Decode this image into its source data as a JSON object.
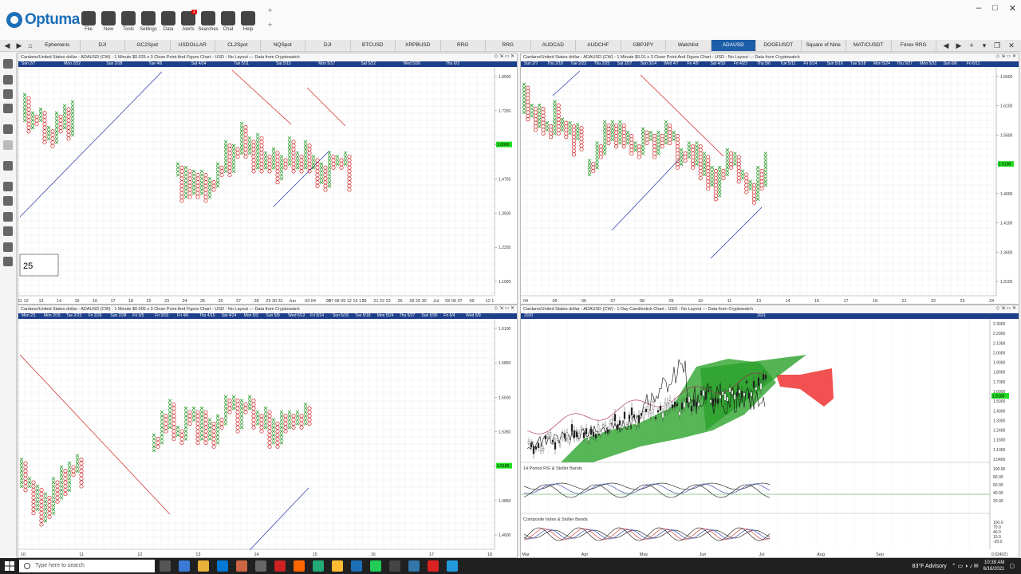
{
  "app": {
    "logo_text": "Optuma",
    "accent": "#1d5ea8",
    "toolbar": [
      {
        "label": "File",
        "icon": "folder-icon"
      },
      {
        "label": "New",
        "icon": "grid-icon"
      },
      {
        "label": "Tools",
        "icon": "tools-icon"
      },
      {
        "label": "Settings",
        "icon": "gear-icon"
      },
      {
        "label": "Data",
        "icon": "binary-icon"
      },
      {
        "label": "Alerts",
        "icon": "clock-alert-icon",
        "badge": "1"
      },
      {
        "label": "Searches",
        "icon": "search-icon"
      },
      {
        "label": "Chat",
        "icon": "chat-icon"
      },
      {
        "label": "Help",
        "icon": "help-icon"
      }
    ]
  },
  "tabs": [
    "Ephemeris",
    "DJI",
    "GC2Spot",
    "USDOLLAR",
    "CL2Spot",
    "NQSpot",
    "DJI",
    "BTCUSD",
    "XRPBUSD",
    "RRG",
    "RRG",
    "AUDCAD",
    "AUDCHF",
    "GBPJPY",
    "Watchlist",
    "ADAUSD",
    "DOGEUSDT",
    "Square of Nine",
    "MATICUSDT",
    "Forex RRG"
  ],
  "active_tab": "ADAUSD",
  "panels": {
    "tl": {
      "title": "Cardano/United States dollar - ADAUSD (CW) - 1 Minute $0.025 x 3 Close Point And Figure Chart - USD - No Layout --- Data from Cryptowatch",
      "dates": [
        "Sun 2/7",
        "Mon 2/22",
        "Sun 2/28",
        "Tue 4/6",
        "Sat 4/24",
        "Tue 5/11",
        "Sat 5/15",
        "Mon 5/17",
        "Sat 5/22",
        "Wed 5/26",
        "Thu 6/3"
      ],
      "yticks": [
        "1.8500",
        "1.7250",
        "1.6000",
        "1.4750",
        "1.3500",
        "1.2250",
        "1.1000"
      ],
      "price_tag": "1.6000",
      "xticks": [
        "11 12",
        "13",
        "14",
        "15",
        "16",
        "17",
        "18",
        "22",
        "23",
        "24",
        "25",
        "26",
        "27",
        "28",
        "29 30 31",
        "Jun",
        "03 04",
        "05",
        "07 08 09 12 16 17",
        "18",
        "21 22 23",
        "26",
        "28 29 30",
        "Jul",
        "05 06 07",
        "09",
        "12 1"
      ],
      "box_label": "25"
    },
    "tr": {
      "title": "Cardano/United States dollar - ADAUSD (CW) - 1 Minute $0.01 x 3 Close Point And Figure Chart - USD - No Layout --- Data from Cryptowatch",
      "dates": [
        "Sun 2/7",
        "Thu 2/18",
        "Tue 2/23",
        "Thu 2/25",
        "Sat 2/27",
        "Sun 3/14",
        "Wed 4/7",
        "Fri 4/9",
        "Sat 4/10",
        "Fri 4/23",
        "Thu 5/6",
        "Tue 5/11",
        "Fri 5/14",
        "Sun 5/16",
        "Tue 5/18",
        "Mon 5/24",
        "Thu 5/27",
        "Mon 5/31",
        "Sun 6/6",
        "Fri 6/11"
      ],
      "yticks": [
        "1.6600",
        "1.6100",
        "1.5600",
        "1.5100",
        "1.4600",
        "1.4100",
        "1.3600",
        "1.3100"
      ],
      "price_tag": "1.5100",
      "xticks": [
        "04",
        "05",
        "06",
        "07",
        "08",
        "09",
        "10",
        "11",
        "13",
        "14",
        "16",
        "17",
        "18",
        "21",
        "22",
        "23",
        "24"
      ]
    },
    "bl": {
      "title": "Cardano/United States dollar - ADAUSD (CW) - 1 Minute $0.005 x 3 Close Point And Figure Chart - USD - No Layout --- Data from Cryptowatch",
      "dates": [
        "Mon 2/1",
        "Mon 2/15",
        "Tue 2/23",
        "Fri 2/26",
        "Sun 2/28",
        "Fri 3/5",
        "Fri 3/19",
        "Fri 4/6",
        "Thu 4/15",
        "Sat 4/24",
        "Mon 5/3",
        "Sun 5/9",
        "Wed 5/12",
        "Fri 5/14",
        "Sun 5/16",
        "Tue 5/18",
        "Mon 5/24",
        "Thu 5/27",
        "Sun 5/30",
        "Fri 6/4",
        "Wed 6/9"
      ],
      "yticks": [
        "1.6100",
        "1.5850",
        "1.5600",
        "1.5350",
        "1.5100",
        "1.4850",
        "1.4600"
      ],
      "price_tag": "1.5100",
      "xticks": [
        "10",
        "11",
        "12",
        "13",
        "14",
        "15",
        "16",
        "17",
        "18"
      ]
    },
    "br": {
      "title": "Cardano/United States dollar - ADAUSD (CW) - 1 Day Candlestick Chart - USD - No Layout --- Data from Cryptowatch",
      "dates": [
        "2020",
        "2021"
      ],
      "yticks": [
        "2.3000",
        "2.2000",
        "2.1000",
        "2.0000",
        "1.9000",
        "1.8000",
        "1.7000",
        "1.6000",
        "1.5000",
        "1.4000",
        "1.3000",
        "1.2400",
        "1.1600",
        "1.1000",
        "1.0400"
      ],
      "price_tag": "1.5100",
      "xticks": [
        "Mar",
        "Apr",
        "May",
        "Jun",
        "Jul",
        "Aug",
        "Sep"
      ],
      "rsi_title": "14 Period RSI & Stoller Bands",
      "rsi_ticks": [
        "100.00",
        "80.00",
        "60.00",
        "40.00",
        "20.00"
      ],
      "ci_title": "Composite Index & Stoller Bands",
      "ci_ticks": [
        "100.0",
        "70.0",
        "40.0",
        "10.0",
        "-20.0"
      ],
      "corner_value": "0.024021"
    }
  },
  "taskbar": {
    "search_placeholder": "Type here to search",
    "weather": "83°F  Advisory",
    "time": "10:39 AM",
    "date": "6/16/2021"
  }
}
